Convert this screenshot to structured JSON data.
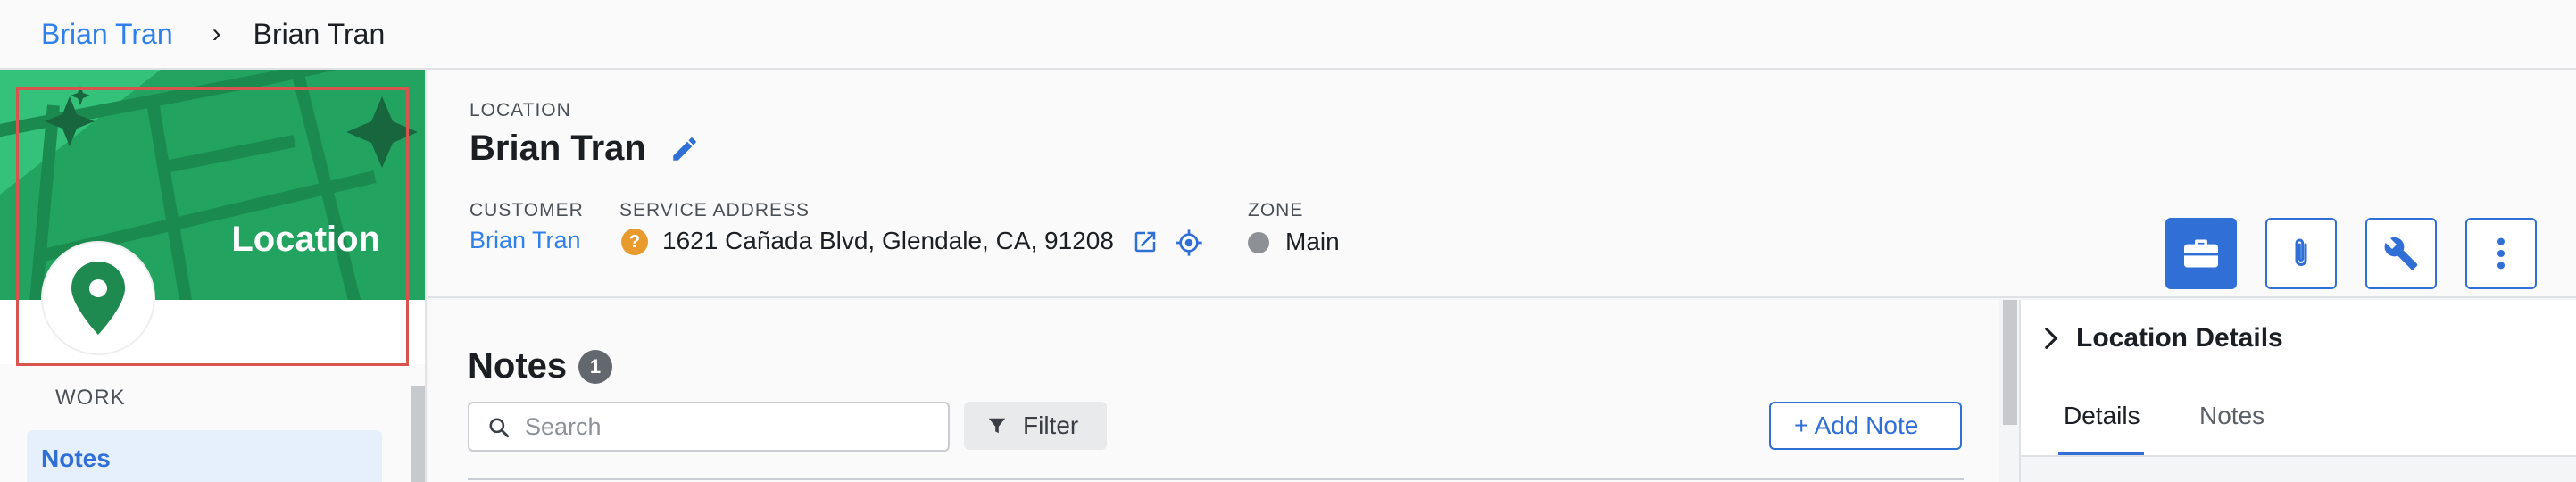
{
  "breadcrumb": {
    "parent_label": "Brian Tran",
    "separator": "›",
    "current_label": "Brian Tran"
  },
  "left_panel": {
    "banner_label": "Location",
    "section_label": "WORK",
    "nav_items": [
      {
        "label": "Notes",
        "active": true
      }
    ]
  },
  "header": {
    "type_label": "LOCATION",
    "title": "Brian Tran",
    "customer": {
      "label": "CUSTOMER",
      "value": "Brian Tran"
    },
    "service_address": {
      "label": "SERVICE ADDRESS",
      "value": "1621 Cañada Blvd, Glendale, CA, 91208",
      "status_icon_text": "?"
    },
    "zone": {
      "label": "ZONE",
      "value": "Main"
    },
    "actions": [
      {
        "name": "briefcase",
        "icon": "briefcase-icon",
        "primary": true
      },
      {
        "name": "attachment",
        "icon": "paperclip-icon",
        "primary": false
      },
      {
        "name": "wrench",
        "icon": "wrench-icon",
        "primary": false
      },
      {
        "name": "more",
        "icon": "kebab-icon",
        "primary": false
      }
    ]
  },
  "notes": {
    "title": "Notes",
    "count": "1",
    "search_placeholder": "Search",
    "search_value": "",
    "filter_label": "Filter",
    "add_note_label": "+ Add Note"
  },
  "right_panel": {
    "title": "Location Details",
    "tabs": [
      {
        "label": "Details",
        "active": true
      },
      {
        "label": "Notes",
        "active": false
      }
    ]
  },
  "colors": {
    "accent": "#2f6fd6",
    "link": "#2f80ed",
    "banner_green": "#22a35f",
    "pin_green": "#1e8a4f",
    "warning": "#e89b2c",
    "zone_gray": "#8d9196",
    "selection_red": "#d9534f"
  }
}
